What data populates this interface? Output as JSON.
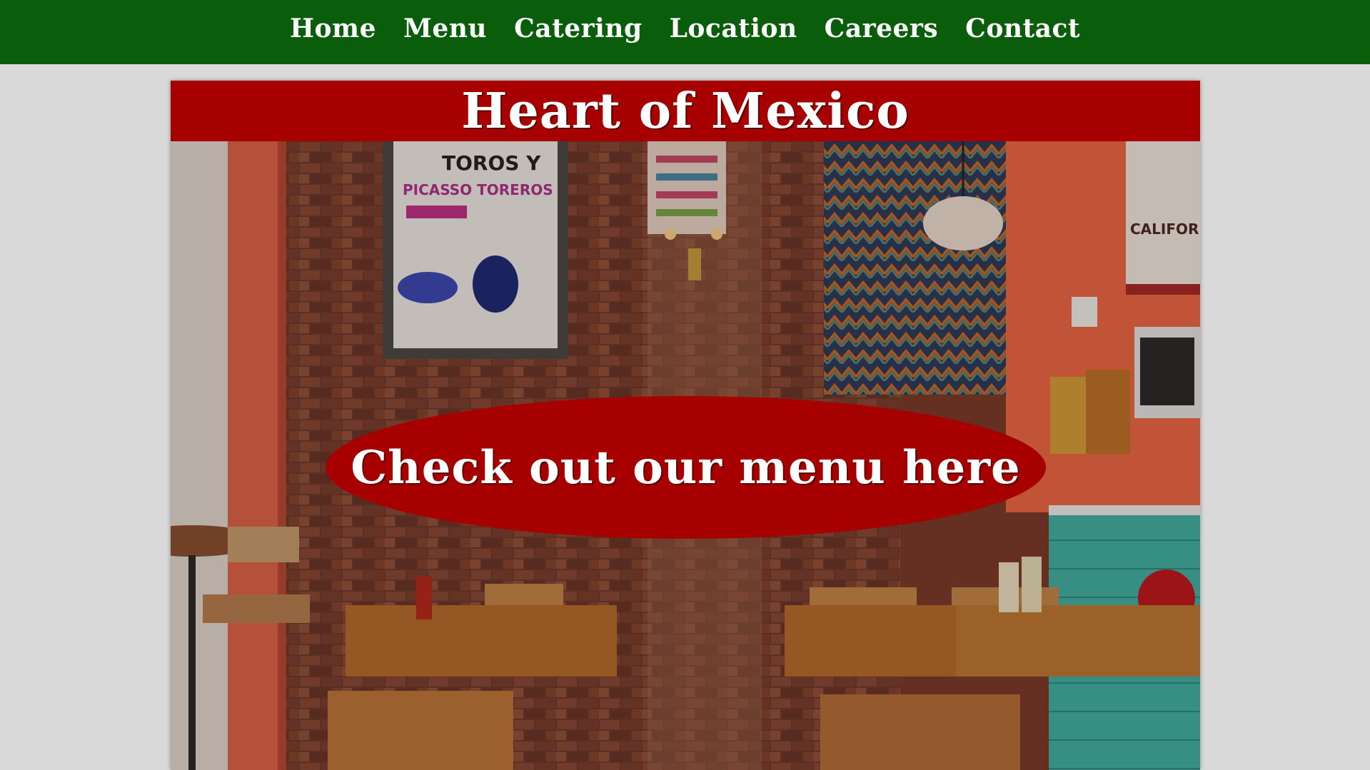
{
  "nav": {
    "items": [
      {
        "label": "Home"
      },
      {
        "label": "Menu"
      },
      {
        "label": "Catering"
      },
      {
        "label": "Location"
      },
      {
        "label": "Careers"
      },
      {
        "label": "Contact"
      }
    ]
  },
  "banner": {
    "title": "Heart of Mexico"
  },
  "hero": {
    "cta_label": "Check out our menu here",
    "poster_lines": [
      "TOROS Y",
      "PICASSO TOREROS"
    ],
    "sign_text": "CALIFORNIA"
  },
  "colors": {
    "nav_bg": "#0a5d0a",
    "banner_bg": "#a60000",
    "cta_bg": "#a60000",
    "page_bg": "#d9d9d9"
  }
}
